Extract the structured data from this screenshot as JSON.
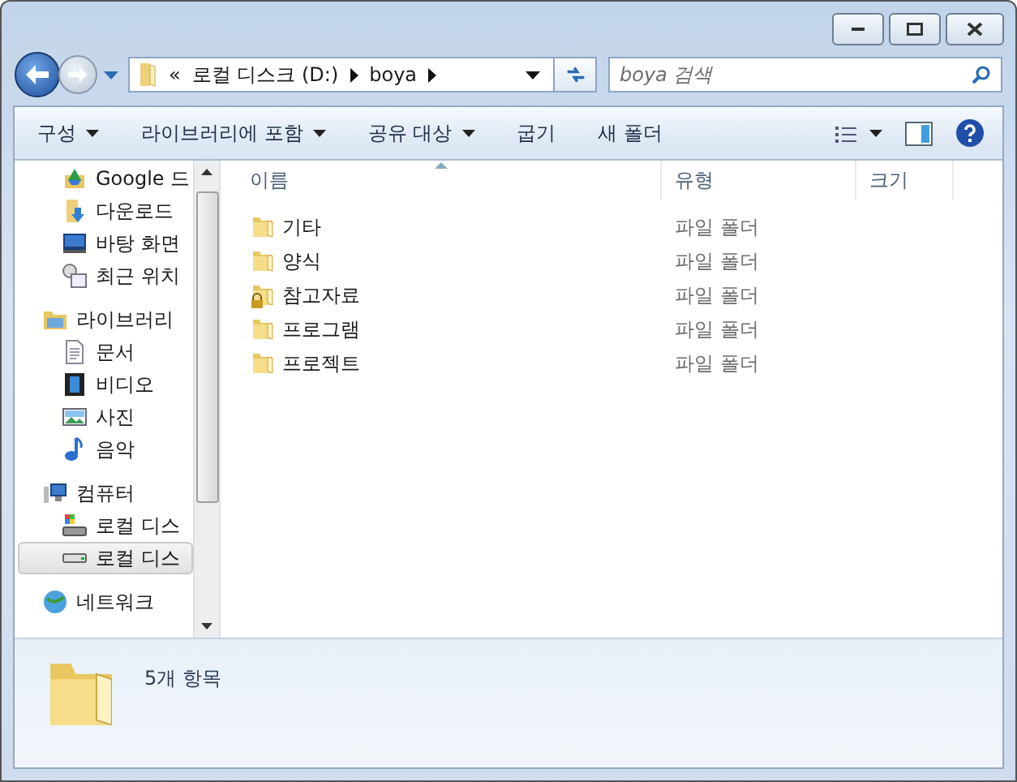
{
  "address_bar": {
    "overflow": "«",
    "crumbs": [
      "로컬 디스크 (D:)",
      "boya"
    ]
  },
  "search": {
    "placeholder": "boya 검색"
  },
  "toolbar": {
    "items": [
      {
        "label": "구성",
        "dropdown": true
      },
      {
        "label": "라이브러리에 포함",
        "dropdown": true
      },
      {
        "label": "공유 대상",
        "dropdown": true
      },
      {
        "label": "굽기",
        "dropdown": false
      },
      {
        "label": "새 폴더",
        "dropdown": false
      }
    ]
  },
  "sidebar": {
    "groups": [
      {
        "children": [
          {
            "label": "Google 드",
            "kind": "drive",
            "selected": false
          },
          {
            "label": "다운로드",
            "kind": "download",
            "selected": false
          },
          {
            "label": "바탕 화면",
            "kind": "desktop",
            "selected": false
          },
          {
            "label": "최근 위치",
            "kind": "recent",
            "selected": false
          }
        ]
      },
      {
        "label": "라이브러리",
        "kind": "library",
        "children": [
          {
            "label": "문서",
            "kind": "document",
            "selected": false
          },
          {
            "label": "비디오",
            "kind": "video",
            "selected": false
          },
          {
            "label": "사진",
            "kind": "picture",
            "selected": false
          },
          {
            "label": "음악",
            "kind": "music",
            "selected": false
          }
        ]
      },
      {
        "label": "컴퓨터",
        "kind": "computer",
        "children": [
          {
            "label": "로컬 디스",
            "kind": "system-disk",
            "selected": false
          },
          {
            "label": "로컬 디스",
            "kind": "disk",
            "selected": true
          }
        ]
      },
      {
        "label": "네트워크",
        "kind": "network"
      }
    ]
  },
  "table": {
    "columns": [
      "이름",
      "유형",
      "크기"
    ],
    "rows": [
      {
        "name": "기타",
        "type": "파일 폴더",
        "locked": false
      },
      {
        "name": "양식",
        "type": "파일 폴더",
        "locked": false
      },
      {
        "name": "참고자료",
        "type": "파일 폴더",
        "locked": true
      },
      {
        "name": "프로그램",
        "type": "파일 폴더",
        "locked": false
      },
      {
        "name": "프로젝트",
        "type": "파일 폴더",
        "locked": false
      }
    ]
  },
  "status_bar": {
    "text": "5개 항목"
  }
}
